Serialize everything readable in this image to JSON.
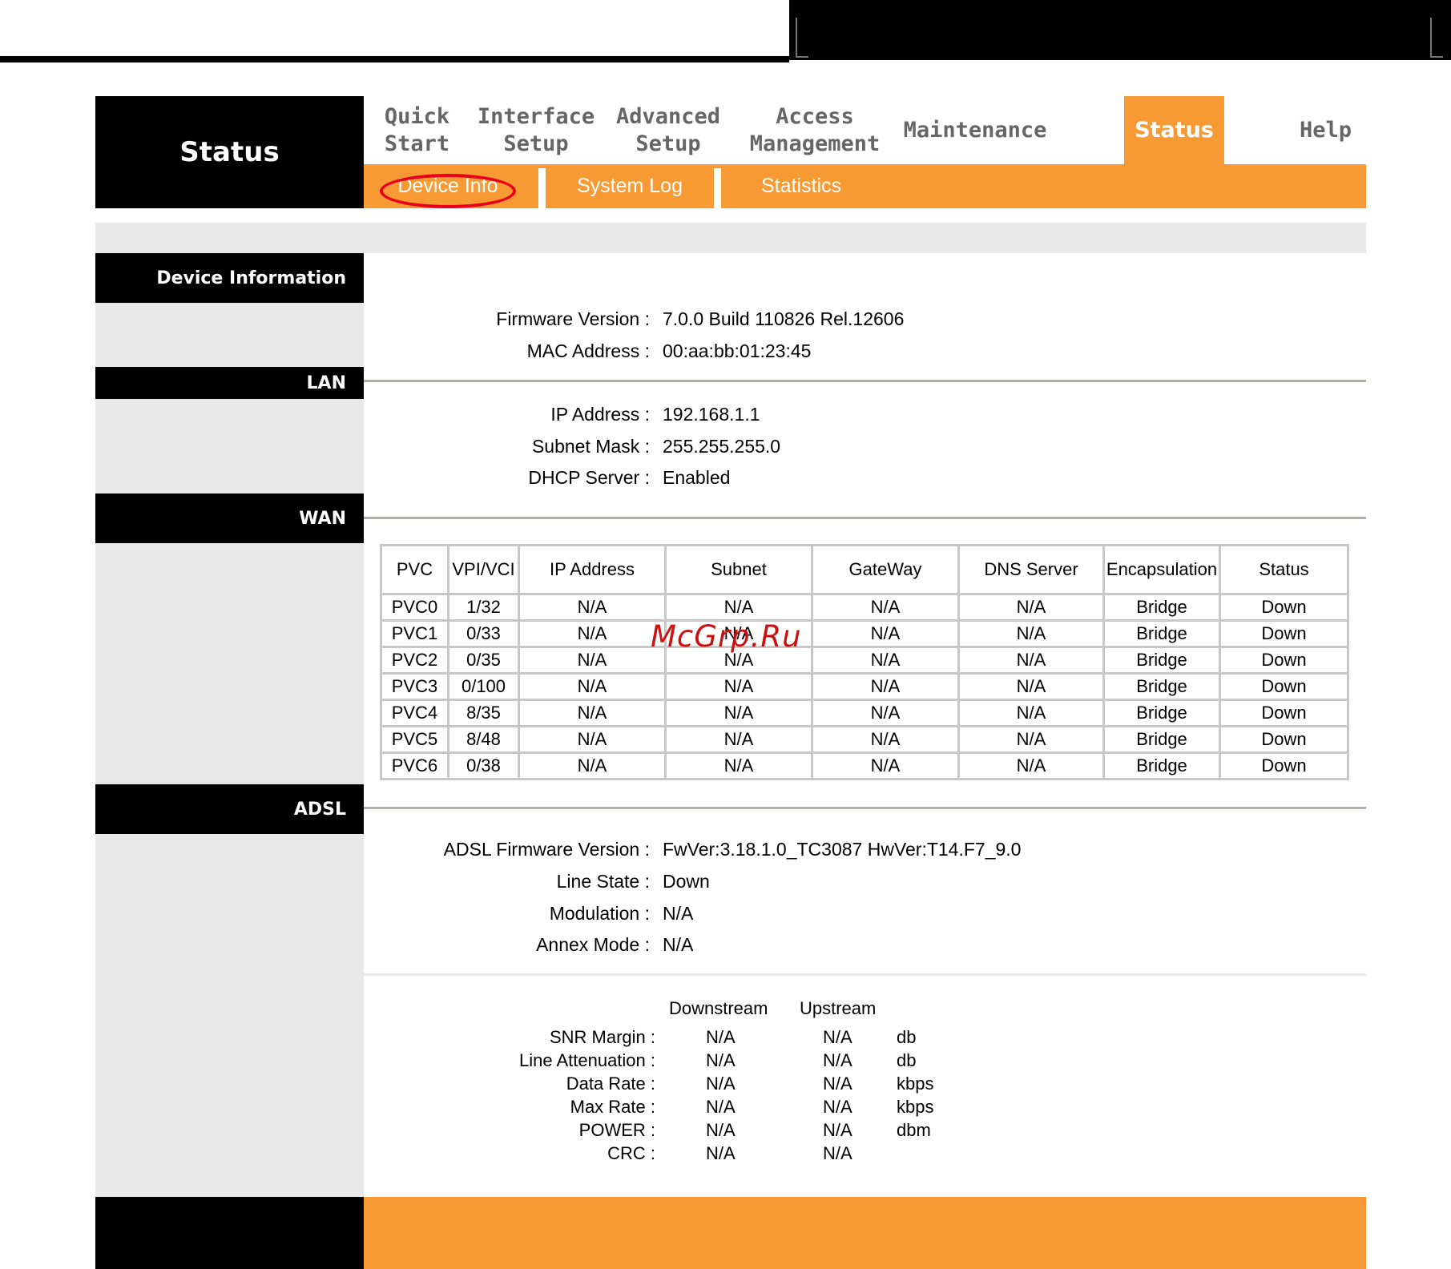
{
  "app_title": "Status",
  "main_tabs": [
    {
      "label": "Quick\nStart",
      "active": false
    },
    {
      "label": "Interface\nSetup",
      "active": false
    },
    {
      "label": "Advanced\nSetup",
      "active": false
    },
    {
      "label": "Access\nManagement",
      "active": false
    },
    {
      "label": "Maintenance",
      "active": false
    },
    {
      "label": "Status",
      "active": true
    },
    {
      "label": "Help",
      "active": false
    }
  ],
  "sub_tabs": [
    {
      "label": "Device Info",
      "active": true
    },
    {
      "label": "System Log",
      "active": false
    },
    {
      "label": "Statistics",
      "active": false
    }
  ],
  "sections": {
    "device_info": "Device Information",
    "lan": "LAN",
    "wan": "WAN",
    "adsl": "ADSL"
  },
  "device_info": {
    "firmware_label": "Firmware Version :",
    "firmware_value": "7.0.0 Build 110826 Rel.12606",
    "mac_label": "MAC Address :",
    "mac_value": "00:aa:bb:01:23:45"
  },
  "lan": {
    "ip_label": "IP Address :",
    "ip_value": "192.168.1.1",
    "mask_label": "Subnet Mask :",
    "mask_value": "255.255.255.0",
    "dhcp_label": "DHCP Server :",
    "dhcp_value": "Enabled"
  },
  "wan": {
    "columns": [
      "PVC",
      "VPI/VCI",
      "IP Address",
      "Subnet",
      "GateWay",
      "DNS Server",
      "Encapsulation",
      "Status"
    ],
    "rows": [
      [
        "PVC0",
        "1/32",
        "N/A",
        "N/A",
        "N/A",
        "N/A",
        "Bridge",
        "Down"
      ],
      [
        "PVC1",
        "0/33",
        "N/A",
        "N/A",
        "N/A",
        "N/A",
        "Bridge",
        "Down"
      ],
      [
        "PVC2",
        "0/35",
        "N/A",
        "N/A",
        "N/A",
        "N/A",
        "Bridge",
        "Down"
      ],
      [
        "PVC3",
        "0/100",
        "N/A",
        "N/A",
        "N/A",
        "N/A",
        "Bridge",
        "Down"
      ],
      [
        "PVC4",
        "8/35",
        "N/A",
        "N/A",
        "N/A",
        "N/A",
        "Bridge",
        "Down"
      ],
      [
        "PVC5",
        "8/48",
        "N/A",
        "N/A",
        "N/A",
        "N/A",
        "Bridge",
        "Down"
      ],
      [
        "PVC6",
        "0/38",
        "N/A",
        "N/A",
        "N/A",
        "N/A",
        "Bridge",
        "Down"
      ]
    ]
  },
  "adsl": {
    "fw_label": "ADSL Firmware Version :",
    "fw_value": "FwVer:3.18.1.0_TC3087 HwVer:T14.F7_9.0",
    "line_state_label": "Line State :",
    "line_state_value": "Down",
    "modulation_label": "Modulation :",
    "modulation_value": "N/A",
    "annex_label": "Annex Mode :",
    "annex_value": "N/A",
    "stats_headers": {
      "downstream": "Downstream",
      "upstream": "Upstream"
    },
    "stats": [
      {
        "label": "SNR Margin :",
        "down": "N/A",
        "up": "N/A",
        "unit": "db"
      },
      {
        "label": "Line Attenuation :",
        "down": "N/A",
        "up": "N/A",
        "unit": "db"
      },
      {
        "label": "Data Rate :",
        "down": "N/A",
        "up": "N/A",
        "unit": "kbps"
      },
      {
        "label": "Max Rate :",
        "down": "N/A",
        "up": "N/A",
        "unit": "kbps"
      },
      {
        "label": "POWER :",
        "down": "N/A",
        "up": "N/A",
        "unit": "dbm"
      },
      {
        "label": "CRC :",
        "down": "N/A",
        "up": "N/A",
        "unit": ""
      }
    ]
  },
  "watermark": "McGrp.Ru",
  "colors": {
    "accent": "#f89a33",
    "panel": "#e8e8e8",
    "highlight_ring": "#e8001c"
  }
}
